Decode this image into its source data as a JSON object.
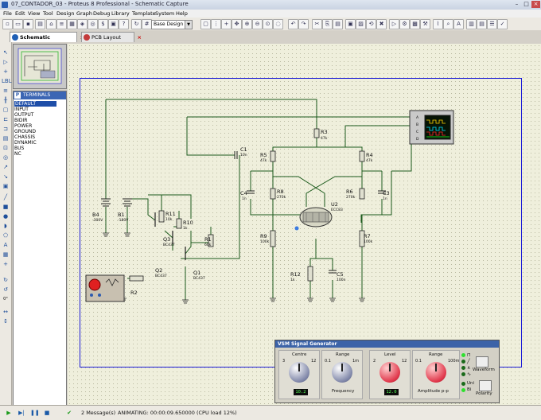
{
  "window": {
    "title": "07_CONTADOR_03 - Proteus 8 Professional - Schematic Capture"
  },
  "menu": [
    "File",
    "Edit",
    "View",
    "Tool",
    "Design",
    "Graph",
    "Debug",
    "Library",
    "Template",
    "System",
    "Help"
  ],
  "toolbar": {
    "design_select": "Base Design"
  },
  "tabs": [
    {
      "label": "Schematic Capture",
      "active": true
    },
    {
      "label": "PCB Layout",
      "active": false
    }
  ],
  "device_panel": {
    "header_icon": "P",
    "header_label": "TERMINALS",
    "items": [
      "DEFAULT",
      "INPUT",
      "OUTPUT",
      "BIDIR",
      "POWER",
      "GROUND",
      "CHASSIS",
      "DYNAMIC",
      "BUS",
      "NC"
    ],
    "selected": "DEFAULT"
  },
  "left_tools": {
    "rotation": "0°"
  },
  "schematic": {
    "components": [
      {
        "ref": "R3",
        "value": "47k"
      },
      {
        "ref": "C1",
        "value": "10n"
      },
      {
        "ref": "R5",
        "value": "47k"
      },
      {
        "ref": "R4",
        "value": "47k"
      },
      {
        "ref": "C4",
        "value": "1n"
      },
      {
        "ref": "R8",
        "value": "270k"
      },
      {
        "ref": "R6",
        "value": "270k"
      },
      {
        "ref": "C3",
        "value": "1n"
      },
      {
        "ref": "U2",
        "value": "ECC83"
      },
      {
        "ref": "B4",
        "value": "-300V"
      },
      {
        "ref": "B1",
        "value": "-180V"
      },
      {
        "ref": "R11",
        "value": "10k"
      },
      {
        "ref": "R10",
        "value": "1k"
      },
      {
        "ref": "R1",
        "value": "60k"
      },
      {
        "ref": "Q3",
        "value": "BC437"
      },
      {
        "ref": "Q2",
        "value": "BC437"
      },
      {
        "ref": "Q1",
        "value": "BC437"
      },
      {
        "ref": "R2",
        "value": ""
      },
      {
        "ref": "R9",
        "value": "100k"
      },
      {
        "ref": "R7",
        "value": "100k"
      },
      {
        "ref": "R12",
        "value": "1k"
      },
      {
        "ref": "C5",
        "value": "100n"
      }
    ],
    "scope_channels": [
      "A",
      "B",
      "C",
      "D"
    ]
  },
  "signal_generator": {
    "title": "VSM Signal Generator",
    "centre": {
      "label": "Centre",
      "display": "10.2",
      "scale": [
        "3",
        "4",
        "5",
        "6",
        "7",
        "8",
        "9",
        "10",
        "11",
        "12",
        "2",
        "1",
        "0"
      ]
    },
    "frequency": {
      "label": "Range",
      "scale": [
        "0.1",
        "1",
        "10",
        "100",
        "1k",
        "10k",
        "100k",
        "1m"
      ],
      "caption": "Frequency"
    },
    "level": {
      "label": "Level",
      "display": "12.0",
      "scale": [
        "2",
        "3",
        "4",
        "5",
        "6",
        "7",
        "8",
        "9",
        "10",
        "11",
        "12",
        "1",
        "0"
      ]
    },
    "amplitude": {
      "label": "Range",
      "scale": [
        "0.1",
        "1",
        "1m",
        "10m",
        "100m"
      ],
      "caption": "Amplitude p-p"
    },
    "waveform_label": "Waveform",
    "polarity_label": "Polarity",
    "uni_label": "Uni",
    "bi_label": "Bi"
  },
  "status": {
    "messages": "2 Message(s)",
    "animating": "ANIMATING: 00:00:09.650000 (CPU load 12%)"
  },
  "colors": {
    "wire": "#1b5a1b",
    "sheet_border": "#1b1bd6",
    "canvas_bg": "#efefdc"
  }
}
